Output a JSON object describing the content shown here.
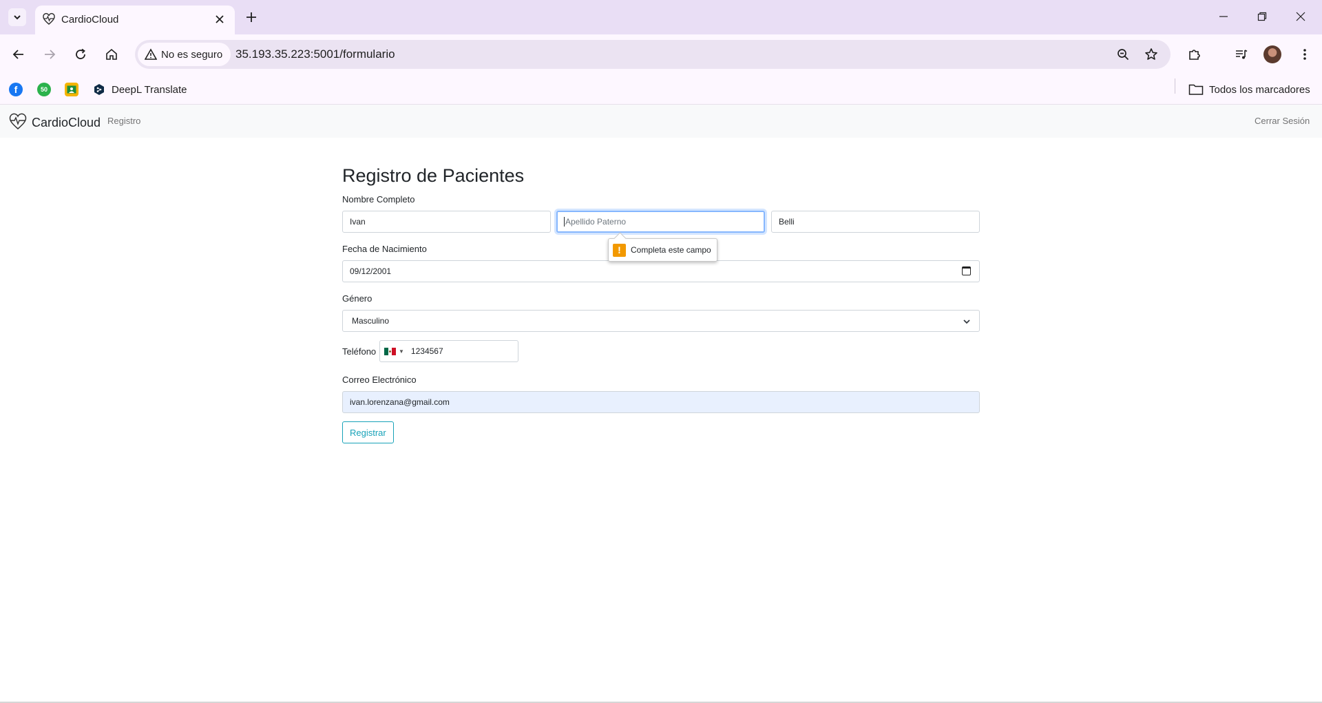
{
  "browser": {
    "tab_title": "CardioCloud",
    "security_label": "No es seguro",
    "url": "35.193.35.223:5001/formulario",
    "bookmarks": {
      "deepl_label": "DeepL Translate",
      "badge_50": "50",
      "all_bookmarks_label": "Todos los marcadores"
    }
  },
  "navbar": {
    "brand": "CardioCloud",
    "register_link": "Registro",
    "logout_link": "Cerrar Sesión"
  },
  "form": {
    "title": "Registro de Pacientes",
    "full_name_label": "Nombre Completo",
    "first_name_value": "Ivan",
    "paternal_placeholder": "Apellido Paterno",
    "maternal_value": "Belli",
    "birthdate_label": "Fecha de Nacimiento",
    "birthdate_value": "09/12/2001",
    "gender_label": "Género",
    "gender_value": "Masculino",
    "phone_label": "Teléfono",
    "phone_value": "1234567",
    "email_label": "Correo Electrónico",
    "email_value": "ivan.lorenzana@gmail.com",
    "submit_label": "Registrar"
  },
  "validation": {
    "message": "Completa este campo"
  },
  "colors": {
    "chrome_tab_bar": "#e9def5",
    "chrome_toolbar": "#fdf7ff",
    "navbar_bg": "#f8f9fa",
    "button_outline": "#17a2b8",
    "focus_ring": "#86b7fe",
    "warning": "#f29900"
  }
}
